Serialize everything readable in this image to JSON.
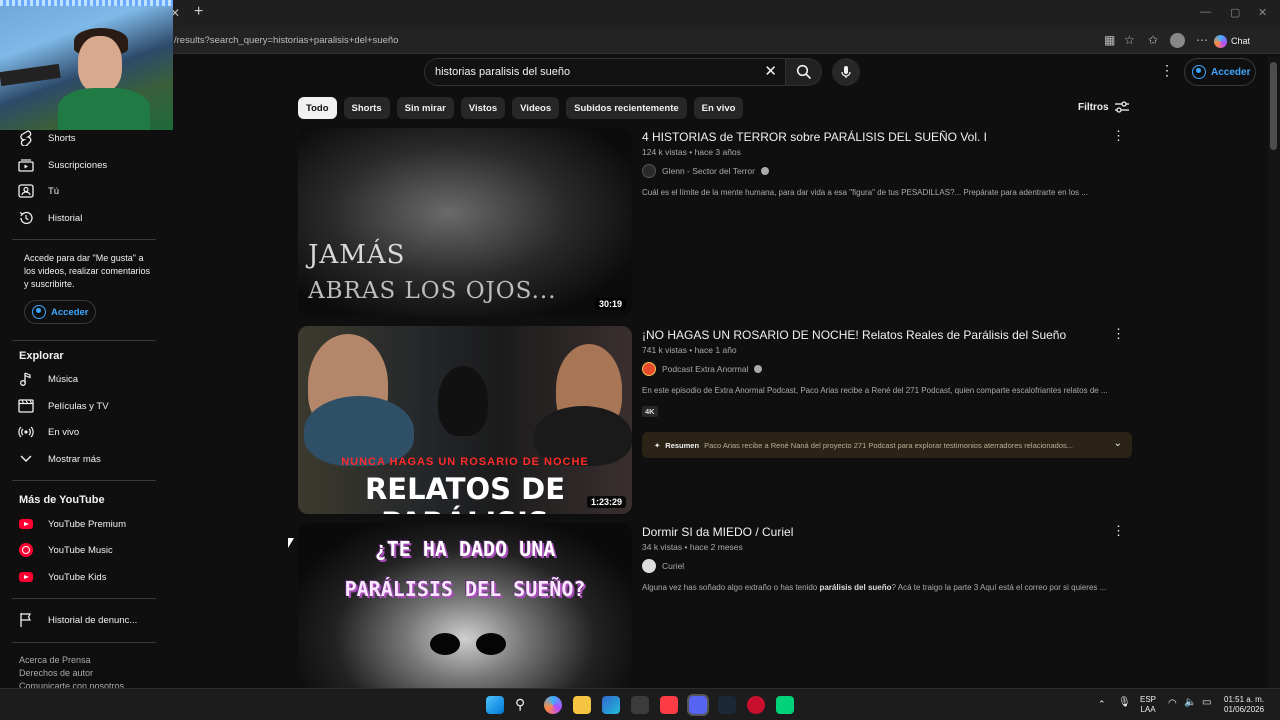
{
  "browser": {
    "url": "/results?search_query=historias+paralisis+del+sueño",
    "copilot_label": "Chat"
  },
  "header": {
    "search_value": "historias paralisis del sueño",
    "signin_label": "Acceder"
  },
  "chips": [
    "Todo",
    "Shorts",
    "Sin mirar",
    "Vistos",
    "Videos",
    "Subidos recientemente",
    "En vivo"
  ],
  "filters_label": "Filtros",
  "sidebar": {
    "items_top": [
      {
        "label": "Shorts",
        "icon": "shorts-icon"
      },
      {
        "label": "Suscripciones",
        "icon": "subscriptions-icon"
      },
      {
        "label": "Tú",
        "icon": "you-icon"
      },
      {
        "label": "Historial",
        "icon": "history-icon"
      }
    ],
    "note": "Accede para dar \"Me gusta\" a los videos, realizar comentarios y suscribirte.",
    "signin_label": "Acceder",
    "explore_heading": "Explorar",
    "explore_items": [
      {
        "label": "Música",
        "icon": "music-icon"
      },
      {
        "label": "Películas y TV",
        "icon": "movies-icon"
      },
      {
        "label": "En vivo",
        "icon": "live-icon"
      },
      {
        "label": "Mostrar más",
        "icon": "chevron-down-icon"
      }
    ],
    "more_heading": "Más de YouTube",
    "more_items": [
      {
        "label": "YouTube Premium",
        "icon": "youtube-premium-icon"
      },
      {
        "label": "YouTube Music",
        "icon": "youtube-music-icon"
      },
      {
        "label": "YouTube Kids",
        "icon": "youtube-kids-icon"
      }
    ],
    "report_history": "Historial de denunc...",
    "footer": [
      "Acerca de  Prensa",
      "Derechos de autor",
      "Comunicarte con nosotros"
    ]
  },
  "results": [
    {
      "title": "4 HISTORIAS de TERROR sobre PARÁLISIS DEL SUEÑO Vol. I",
      "meta": "124 k vistas • hace 3 años",
      "channel": "Glenn - Sector del Terror",
      "description": "Cuál es el límite de la mente humana, para dar vida a esa \"figura\" de tus PESADILLAS?... Prepárate para adentrarte en los ...",
      "duration": "30:19",
      "thumb_line1": "JAMÁS",
      "thumb_line2": "ABRAS LOS OJOS..."
    },
    {
      "title": "¡NO HAGAS UN ROSARIO DE NOCHE! Relatos Reales de Parálisis del Sueño",
      "meta": "741 k vistas • hace 1 año",
      "channel": "Podcast Extra Anormal",
      "description": "En este episodio de Extra Anormal Podcast, Paco Arias recibe a René del 271 Podcast, quien comparte escalofriantes relatos de ...",
      "badge": "4K",
      "summary_label": "Resumen",
      "summary_text": "Paco Arias recibe a René Naná del proyecto 271 Podcast para explorar testimonios aterradores relacionados...",
      "duration": "1:23:29",
      "thumb_line1": "NUNCA HAGAS UN ROSARIO DE NOCHE",
      "thumb_line2": "RELATOS DE PARÁLISIS"
    },
    {
      "title": "Dormir SI da MIEDO / Curiel",
      "meta": "34 k vistas • hace 2 meses",
      "channel": "Curiel",
      "description_pre": "Alguna vez has soñado algo extraño o has tenido ",
      "description_bold": "parálisis del sueño",
      "description_post": "? Acá te traigo la parte 3 Aquí está el correo por si quieres ...",
      "thumb_line1": "¿TE HA DADO UNA",
      "thumb_line2": "PARÁLISIS DEL SUEÑO?"
    }
  ],
  "taskbar": {
    "lang_top": "ESP",
    "lang_bottom": "LAA",
    "time": "01:51 a. m.",
    "date": "01/06/2026"
  },
  "colors": {
    "background": "#0f0f0f",
    "accent_link": "#3ea6ff",
    "youtube_red": "#ff0033"
  }
}
